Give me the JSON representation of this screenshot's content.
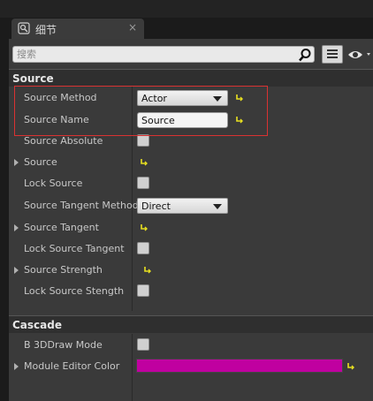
{
  "tab": {
    "title": "细节",
    "close_label": "×"
  },
  "search": {
    "placeholder": "搜索",
    "value": ""
  },
  "categories": [
    {
      "label": "Source"
    },
    {
      "label": "Cascade"
    }
  ],
  "rows": {
    "source_method": {
      "label": "Source Method",
      "value": "Actor"
    },
    "source_name": {
      "label": "Source Name",
      "value": "Source"
    },
    "source_absolute": {
      "label": "Source Absolute"
    },
    "source": {
      "label": "Source"
    },
    "lock_source": {
      "label": "Lock Source"
    },
    "source_tangent_method": {
      "label": "Source Tangent Method",
      "value": "Direct"
    },
    "source_tangent": {
      "label": "Source Tangent"
    },
    "lock_source_tangent": {
      "label": "Lock Source Tangent"
    },
    "source_strength": {
      "label": "Source Strength"
    },
    "lock_source_stength": {
      "label": "Lock Source Stength"
    },
    "b_3ddraw_mode": {
      "label": "B 3DDraw Mode"
    },
    "module_editor_color": {
      "label": "Module Editor Color",
      "color": "#c000a0"
    }
  },
  "colors": {
    "panel": "#3a3a3a",
    "highlight": "#d93232",
    "reset_arrow": "#e8e020"
  },
  "icons": [
    "details-tab-icon",
    "search-icon",
    "list-view-icon",
    "eye-icon",
    "reset-arrow-icon"
  ]
}
